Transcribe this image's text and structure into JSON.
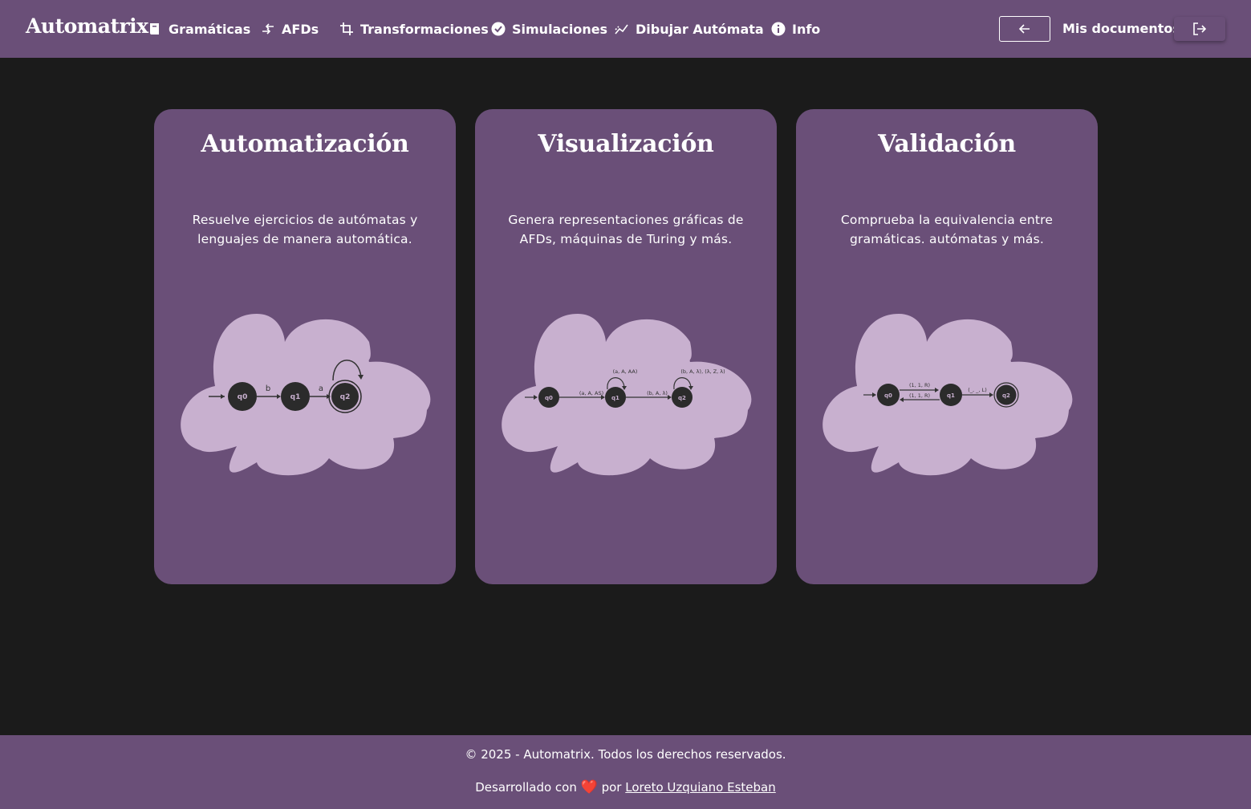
{
  "header": {
    "brand": "Automatrix",
    "nav": [
      {
        "label": "Gramáticas",
        "icon": "book-icon"
      },
      {
        "label": "AFDs",
        "icon": "transfer-arrows-icon"
      },
      {
        "label": "Transformaciones",
        "icon": "crop-icon"
      },
      {
        "label": "Simulaciones",
        "icon": "check-circle-icon"
      },
      {
        "label": "Dibujar Autómata",
        "icon": "chart-line-icon"
      },
      {
        "label": "Info",
        "icon": "info-circle-icon"
      }
    ],
    "docs_label": "Mis documentos"
  },
  "cards": [
    {
      "title": "Automatización",
      "description": "Resuelve ejercicios de autómatas y lenguajes de manera automática.",
      "diagram": {
        "states": [
          "q0",
          "q1",
          "q2"
        ],
        "edges": [
          "b",
          "a"
        ]
      }
    },
    {
      "title": "Visualización",
      "description": "Genera representaciones gráficas de AFDs, máquinas de Turing y más.",
      "diagram": {
        "states": [
          "q0",
          "q1",
          "q2"
        ],
        "edges": [
          "(a, A, AS)",
          "(b, A, λ)"
        ],
        "loops": [
          "(a, A, AA)",
          "(b, A, λ), (λ, Z, λ)"
        ]
      }
    },
    {
      "title": "Validación",
      "description": "Comprueba la equivalencia entre gramáticas. autómatas y más.",
      "diagram": {
        "states": [
          "q0",
          "q1",
          "q2"
        ],
        "edges": [
          "(1, 1, R)",
          "(1, 1, R)",
          "(_, _, L)"
        ]
      }
    }
  ],
  "footer": {
    "copyright": "© 2025 - Automatrix. Todos los derechos reservados.",
    "dev_prefix": "Desarrollado con",
    "dev_middle": "por",
    "author": "Loreto Uzquiano Esteban"
  },
  "colors": {
    "primary": "#6a4f78",
    "background": "#1b1b1b",
    "cloud": "#c8b0cf",
    "node": "#2b2b2b"
  }
}
